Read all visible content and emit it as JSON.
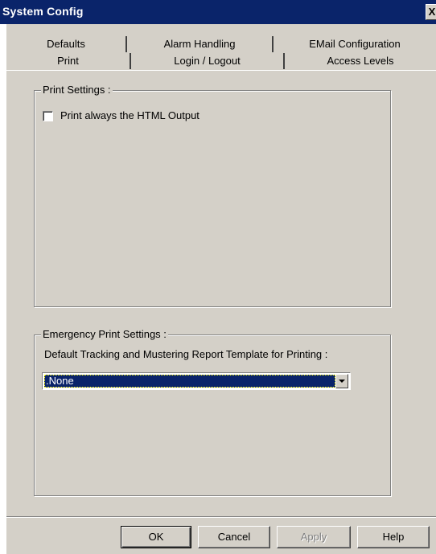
{
  "window": {
    "title": "System Config",
    "close_glyph": "X"
  },
  "tabs": {
    "row1": [
      {
        "label": "Defaults"
      },
      {
        "label": "Alarm Handling"
      },
      {
        "label": "EMail Configuration"
      }
    ],
    "row2": [
      {
        "label": "Print",
        "active": true
      },
      {
        "label": "Login / Logout"
      },
      {
        "label": "Access Levels"
      }
    ]
  },
  "print_settings": {
    "legend": "Print Settings :",
    "checkbox_label": "Print always the HTML Output",
    "checked": false
  },
  "emergency": {
    "legend": "Emergency Print Settings :",
    "template_label": "Default Tracking and Mustering Report Template for Printing :",
    "template_selected": ".None"
  },
  "buttons": {
    "ok": "OK",
    "cancel": "Cancel",
    "apply": "Apply",
    "help": "Help"
  },
  "colors": {
    "titlebar": "#0a246a",
    "face": "#d4d0c8",
    "selection": "#0a246a"
  }
}
